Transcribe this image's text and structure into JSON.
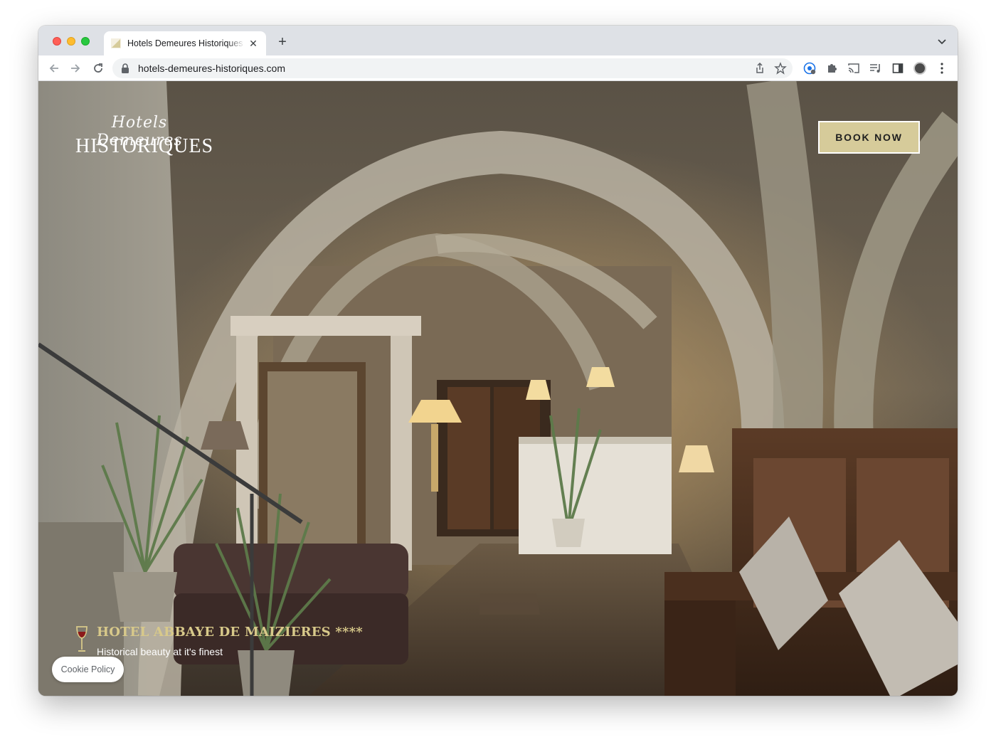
{
  "browser": {
    "tab": {
      "title": "Hotels Demeures Historiques Bourgogne",
      "close_glyph": "✕"
    },
    "new_tab_glyph": "+",
    "address_bar": {
      "url": "hotels-demeures-historiques.com"
    },
    "icons": {
      "back": "arrow-left-icon",
      "forward": "arrow-right-icon",
      "reload": "reload-icon",
      "lock": "lock-icon",
      "share": "share-icon",
      "bookmark": "star-icon",
      "extensions": [
        "password-manager-icon",
        "puzzle-extension-icon",
        "cast-icon",
        "media-queue-icon",
        "side-panel-icon",
        "profile-avatar",
        "more-menu-icon"
      ]
    }
  },
  "page": {
    "logo": {
      "script_text": "Hotels Demeures",
      "main_text": "HISTORIQUES"
    },
    "book_now_label": "BOOK NOW",
    "featured_hotel": {
      "name": "HOTEL ABBAYE DE MAIZIERES ****",
      "tagline": "Historical beauty at it's finest",
      "icon": "wine-glass-icon"
    },
    "cookie_policy_label": "Cookie Policy",
    "colors": {
      "book_button": "#d6cb9a",
      "hotel_title": "#d8c98a",
      "wine_glass": "#8b1a1a"
    }
  }
}
